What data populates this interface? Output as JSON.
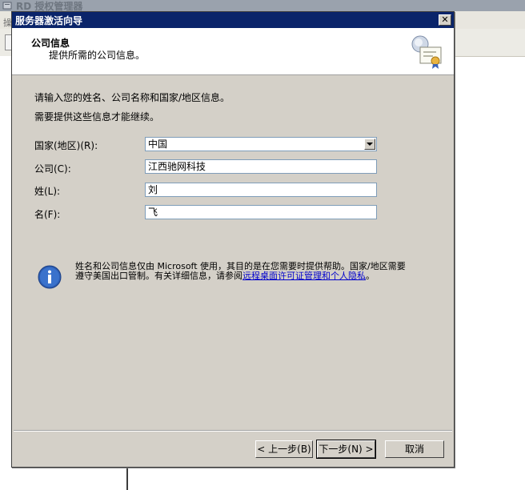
{
  "parent_window": {
    "title": "RD 授权管理器",
    "menu_stub": "操"
  },
  "dialog": {
    "title": "服务器激活向导",
    "close_glyph": "✕",
    "header": {
      "title": "公司信息",
      "subtitle": "提供所需的公司信息。"
    },
    "intro_line1": "请输入您的姓名、公司名称和国家/地区信息。",
    "intro_line2": "需要提供这些信息才能继续。",
    "form": {
      "country_label": "国家(地区)(R):",
      "country_value": "中国",
      "company_label": "公司(C):",
      "company_value": "江西驰网科技",
      "last_name_label": "姓(L):",
      "last_name_value": "刘",
      "first_name_label": "名(F):",
      "first_name_value": "飞"
    },
    "info": {
      "icon": "info-icon",
      "text_before": "姓名和公司信息仅由 Microsoft 使用，其目的是在您需要时提供帮助。国家/地区需要遵守美国出口管制。有关详细信息，请参阅",
      "link_text": "远程桌面许可证管理和个人隐私",
      "text_after": "。"
    },
    "buttons": {
      "back": "< 上一步(B)",
      "next": "下一步(N) >",
      "cancel": "取消"
    }
  }
}
